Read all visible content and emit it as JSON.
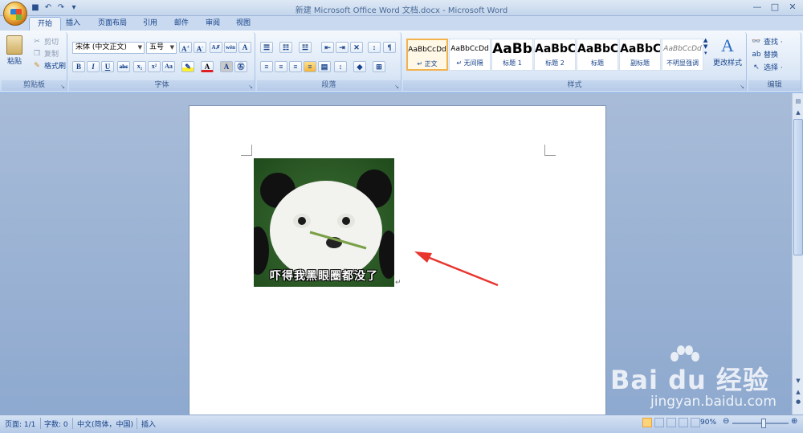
{
  "window": {
    "title": "新建 Microsoft Office Word 文档.docx - Microsoft Word"
  },
  "tabs": [
    "开始",
    "插入",
    "页面布局",
    "引用",
    "邮件",
    "审阅",
    "视图"
  ],
  "ribbon": {
    "clipboard": {
      "paste": "粘贴",
      "cut": "剪切",
      "copy": "复制",
      "format_painter": "格式刷",
      "label": "剪贴板"
    },
    "font": {
      "font_name": "宋体 (中文正文)",
      "font_size": "五号",
      "label": "字体"
    },
    "paragraph": {
      "label": "段落"
    },
    "styles": {
      "items": [
        {
          "sample": "AaBbCcDd",
          "name": "↵ 正文"
        },
        {
          "sample": "AaBbCcDd",
          "name": "↵ 无间隔"
        },
        {
          "sample": "AaBb",
          "name": "标题 1"
        },
        {
          "sample": "AaBbC",
          "name": "标题 2"
        },
        {
          "sample": "AaBbC",
          "name": "标题"
        },
        {
          "sample": "AaBbC",
          "name": "副标题"
        },
        {
          "sample": "AaBbCcDd",
          "name": "不明显强调"
        }
      ],
      "change_styles": "更改样式",
      "label": "样式"
    },
    "editing": {
      "find": "查找 ·",
      "replace": "替换",
      "select": "选择 ·",
      "label": "编辑"
    }
  },
  "document": {
    "image_caption": "吓得我黑眼圈都没了"
  },
  "statusbar": {
    "page": "页面: 1/1",
    "words": "字数: 0",
    "language": "中文(简体，中国)",
    "mode": "插入",
    "zoom": "90%"
  },
  "watermark": {
    "brand": "Bai du 经验",
    "url": "jingyan.baidu.com"
  },
  "colors": {
    "arrow": "#e8352e",
    "ribbon_text": "#15428b"
  }
}
